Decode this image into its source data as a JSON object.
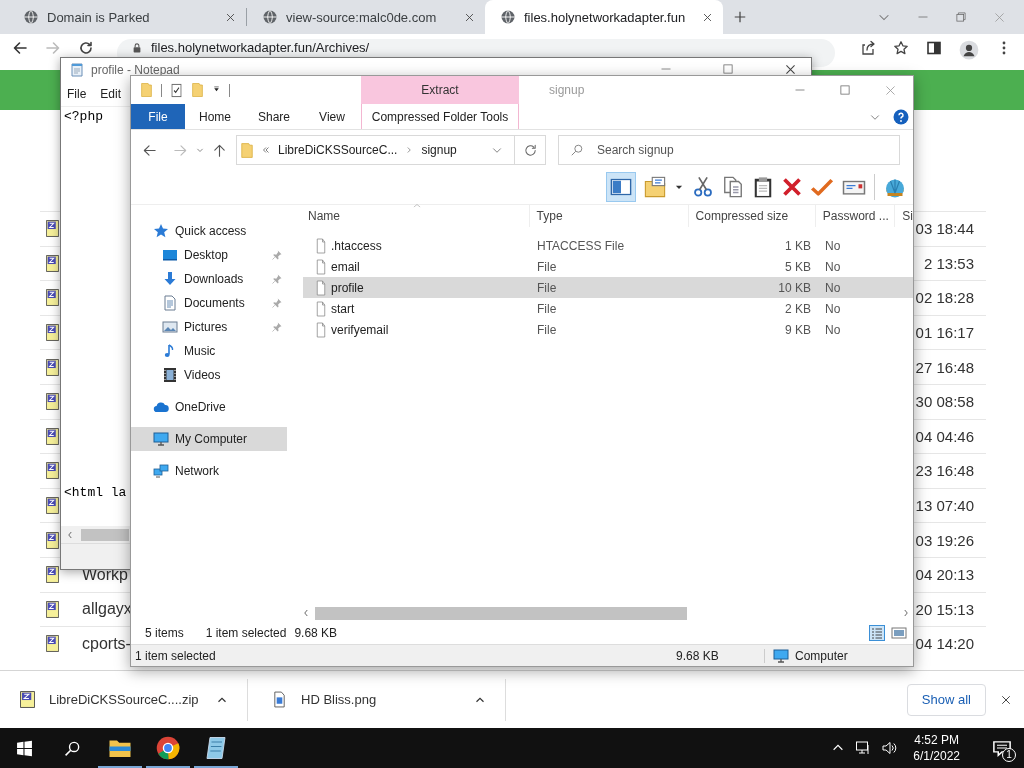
{
  "browser": {
    "tabs": [
      {
        "title": "Domain is Parked",
        "selected": false
      },
      {
        "title": "view-source:malc0de.com",
        "selected": false
      },
      {
        "title": "files.holynetworkadapter.fun",
        "selected": true
      }
    ],
    "address": "files.holynetworkadapter.fun/Archives/",
    "listing": [
      {
        "modified": "03 18:44"
      },
      {
        "modified": "2 13:53"
      },
      {
        "modified": "02 18:28"
      },
      {
        "modified": "01 16:17"
      },
      {
        "modified": "27 16:48"
      },
      {
        "modified": "30 08:58"
      },
      {
        "modified": "04 04:46"
      },
      {
        "modified": "23 16:48"
      },
      {
        "modified": "13 07:40"
      },
      {
        "modified": "03 19:26"
      },
      {
        "name": "Workp",
        "modified": "04 20:13"
      },
      {
        "name": "allgayx",
        "modified": "20 15:13"
      },
      {
        "name": "cports-",
        "modified": "04 14:20"
      }
    ]
  },
  "notepad": {
    "title": "profile - Notepad",
    "menu": [
      "File",
      "Edit"
    ],
    "lines": [
      "<?php",
      "<html la"
    ]
  },
  "explorer": {
    "context_tab": "Extract",
    "title": "signup",
    "ribbon_tabs": [
      {
        "label": "File",
        "kind": "file"
      },
      {
        "label": "Home",
        "kind": "tab"
      },
      {
        "label": "Share",
        "kind": "tab"
      },
      {
        "label": "View",
        "kind": "tab"
      },
      {
        "label": "Compressed Folder Tools",
        "kind": "context"
      }
    ],
    "path": [
      "LibreDiCKSSourceC...",
      "signup"
    ],
    "search_placeholder": "Search signup",
    "nav": [
      {
        "label": "Quick access",
        "kind": "quick",
        "selected": false,
        "children": [
          {
            "label": "Desktop",
            "kind": "desktop",
            "pinned": true,
            "selected": false
          },
          {
            "label": "Downloads",
            "kind": "downloads",
            "pinned": true,
            "selected": false
          },
          {
            "label": "Documents",
            "kind": "documents",
            "pinned": true,
            "selected": false
          },
          {
            "label": "Pictures",
            "kind": "pictures",
            "pinned": true,
            "selected": false
          },
          {
            "label": "Music",
            "kind": "music",
            "pinned": false,
            "selected": false
          },
          {
            "label": "Videos",
            "kind": "videos",
            "pinned": false,
            "selected": false
          }
        ]
      },
      {
        "label": "OneDrive",
        "kind": "onedrive",
        "selected": false
      },
      {
        "label": "My Computer",
        "kind": "computer",
        "selected": true
      },
      {
        "label": "Network",
        "kind": "network",
        "selected": false
      }
    ],
    "columns": [
      "Name",
      "Type",
      "Compressed size",
      "Password ...",
      "Si"
    ],
    "files": [
      {
        "name": ".htaccess",
        "type": "HTACCESS File",
        "size": "1 KB",
        "password": "No",
        "selected": false
      },
      {
        "name": "email",
        "type": "File",
        "size": "5 KB",
        "password": "No",
        "selected": false
      },
      {
        "name": "profile",
        "type": "File",
        "size": "10 KB",
        "password": "No",
        "selected": true
      },
      {
        "name": "start",
        "type": "File",
        "size": "2 KB",
        "password": "No",
        "selected": false
      },
      {
        "name": "verifyemail",
        "type": "File",
        "size": "9 KB",
        "password": "No",
        "selected": false
      }
    ],
    "status": {
      "count": "5 items",
      "selection": "1 item selected",
      "size": "9.68 KB"
    },
    "status_bar": {
      "selection": "1 item selected",
      "size": "9.68 KB",
      "location": "Computer"
    }
  },
  "downloads": {
    "items": [
      {
        "name": "LibreDiCKSSourceC....zip",
        "kind": "zip"
      },
      {
        "name": "HD Bliss.png",
        "kind": "image"
      }
    ],
    "show_all": "Show all"
  },
  "taskbar": {
    "apps": [
      {
        "kind": "explorer",
        "running": true
      },
      {
        "kind": "chrome",
        "running": true
      },
      {
        "kind": "notepad",
        "running": true
      }
    ],
    "time": "4:52 PM",
    "date": "6/1/2022",
    "notifications": "1"
  }
}
